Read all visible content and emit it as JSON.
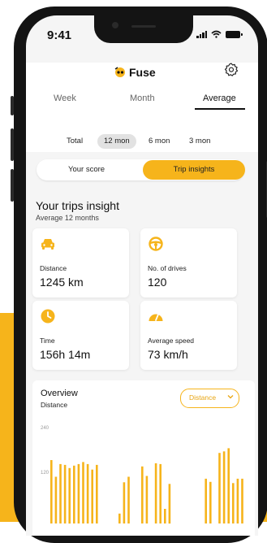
{
  "status": {
    "time": "9:41"
  },
  "app": {
    "name": "Fuse"
  },
  "tabs": [
    {
      "label": "Week"
    },
    {
      "label": "Month"
    },
    {
      "label": "Average"
    }
  ],
  "periods": [
    {
      "label": "Total"
    },
    {
      "label": "12 mon"
    },
    {
      "label": "6 mon"
    },
    {
      "label": "3 mon"
    }
  ],
  "selected_tab": "Average",
  "selected_period": "12 mon",
  "segments": {
    "left": "Your score",
    "right": "Trip insights"
  },
  "insights": {
    "title": "Your trips insight",
    "subtitle": "Average 12 months"
  },
  "stats": {
    "distance": {
      "label": "Distance",
      "value": "1245 km",
      "icon": "car-icon"
    },
    "drives": {
      "label": "No. of drives",
      "value": "120",
      "icon": "steering-wheel-icon"
    },
    "time": {
      "label": "Time",
      "value": "156h 14m",
      "icon": "clock-icon"
    },
    "speed": {
      "label": "Average speed",
      "value": "73 km/h",
      "icon": "speedometer-icon"
    }
  },
  "overview": {
    "title": "Overview",
    "subtitle": "Distance",
    "dropdown": "Distance"
  },
  "colors": {
    "accent": "#f6b41b",
    "background": "#f5f5f5",
    "card": "#ffffff"
  },
  "chart_data": {
    "type": "bar",
    "ylim": [
      0,
      240
    ],
    "yticks": [
      "240",
      "120"
    ],
    "values": [
      160,
      118,
      150,
      148,
      140,
      146,
      150,
      155,
      150,
      136,
      148,
      0,
      0,
      0,
      0,
      25,
      104,
      118,
      0,
      0,
      144,
      120,
      0,
      152,
      150,
      37,
      100,
      0,
      0,
      0,
      0,
      0,
      0,
      0,
      113,
      105,
      0,
      178,
      182,
      190,
      102,
      113,
      113
    ]
  }
}
